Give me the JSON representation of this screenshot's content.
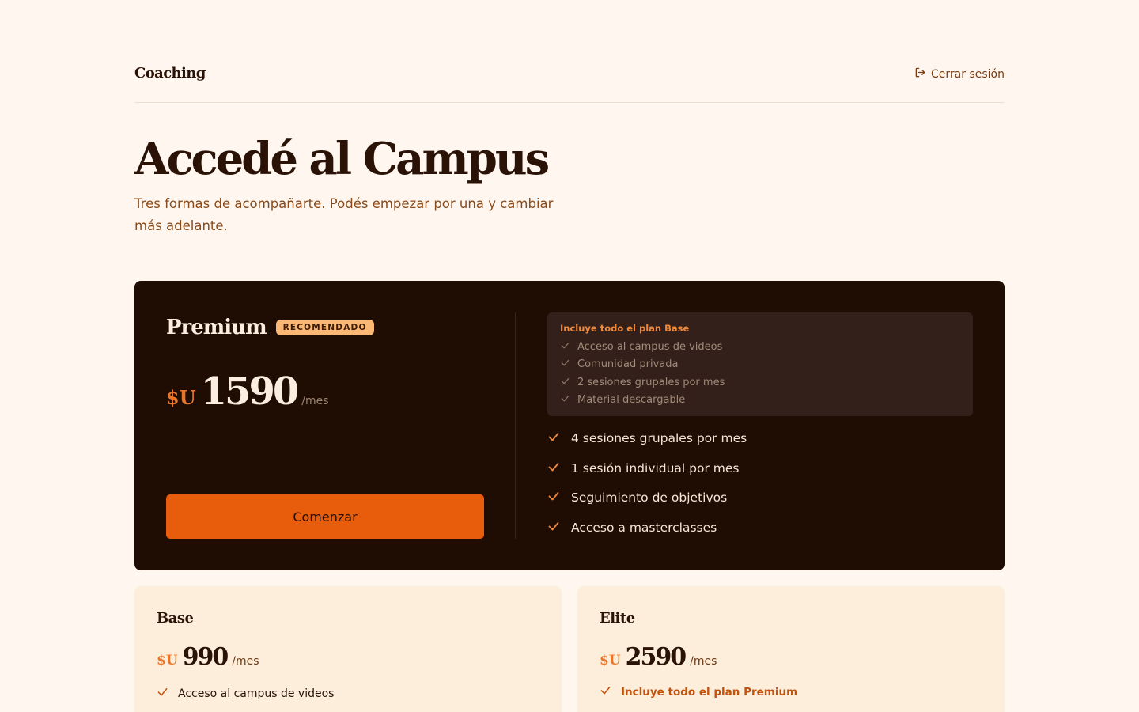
{
  "header": {
    "brand": "Coaching",
    "logout_label": "Cerrar sesión"
  },
  "hero": {
    "title": "Accedé al Campus",
    "subtitle": "Tres formas de acompañarte. Podés empezar por una y cambiar más adelante."
  },
  "premium": {
    "name": "Premium",
    "badge": "RECOMENDADO",
    "currency": "$U",
    "price": "1590",
    "period": "/mes",
    "cta": "Comenzar",
    "includes_title": "Incluye todo el plan Base",
    "includes_items": [
      "Acceso al campus de videos",
      "Comunidad privada",
      "2 sesiones grupales por mes",
      "Material descargable"
    ],
    "features": [
      "4 sesiones grupales por mes",
      "1 sesión individual por mes",
      "Seguimiento de objetivos",
      "Acceso a masterclasses"
    ]
  },
  "base": {
    "name": "Base",
    "currency": "$U",
    "price": "990",
    "period": "/mes",
    "first_feature": "Acceso al campus de videos"
  },
  "elite": {
    "name": "Elite",
    "currency": "$U",
    "price": "2590",
    "period": "/mes",
    "first_feature": "Incluye todo el plan Premium"
  },
  "colors": {
    "background": "#fff7ef",
    "dark_card": "#1f0d04",
    "accent": "#e85d0c",
    "badge": "#fbb774"
  }
}
